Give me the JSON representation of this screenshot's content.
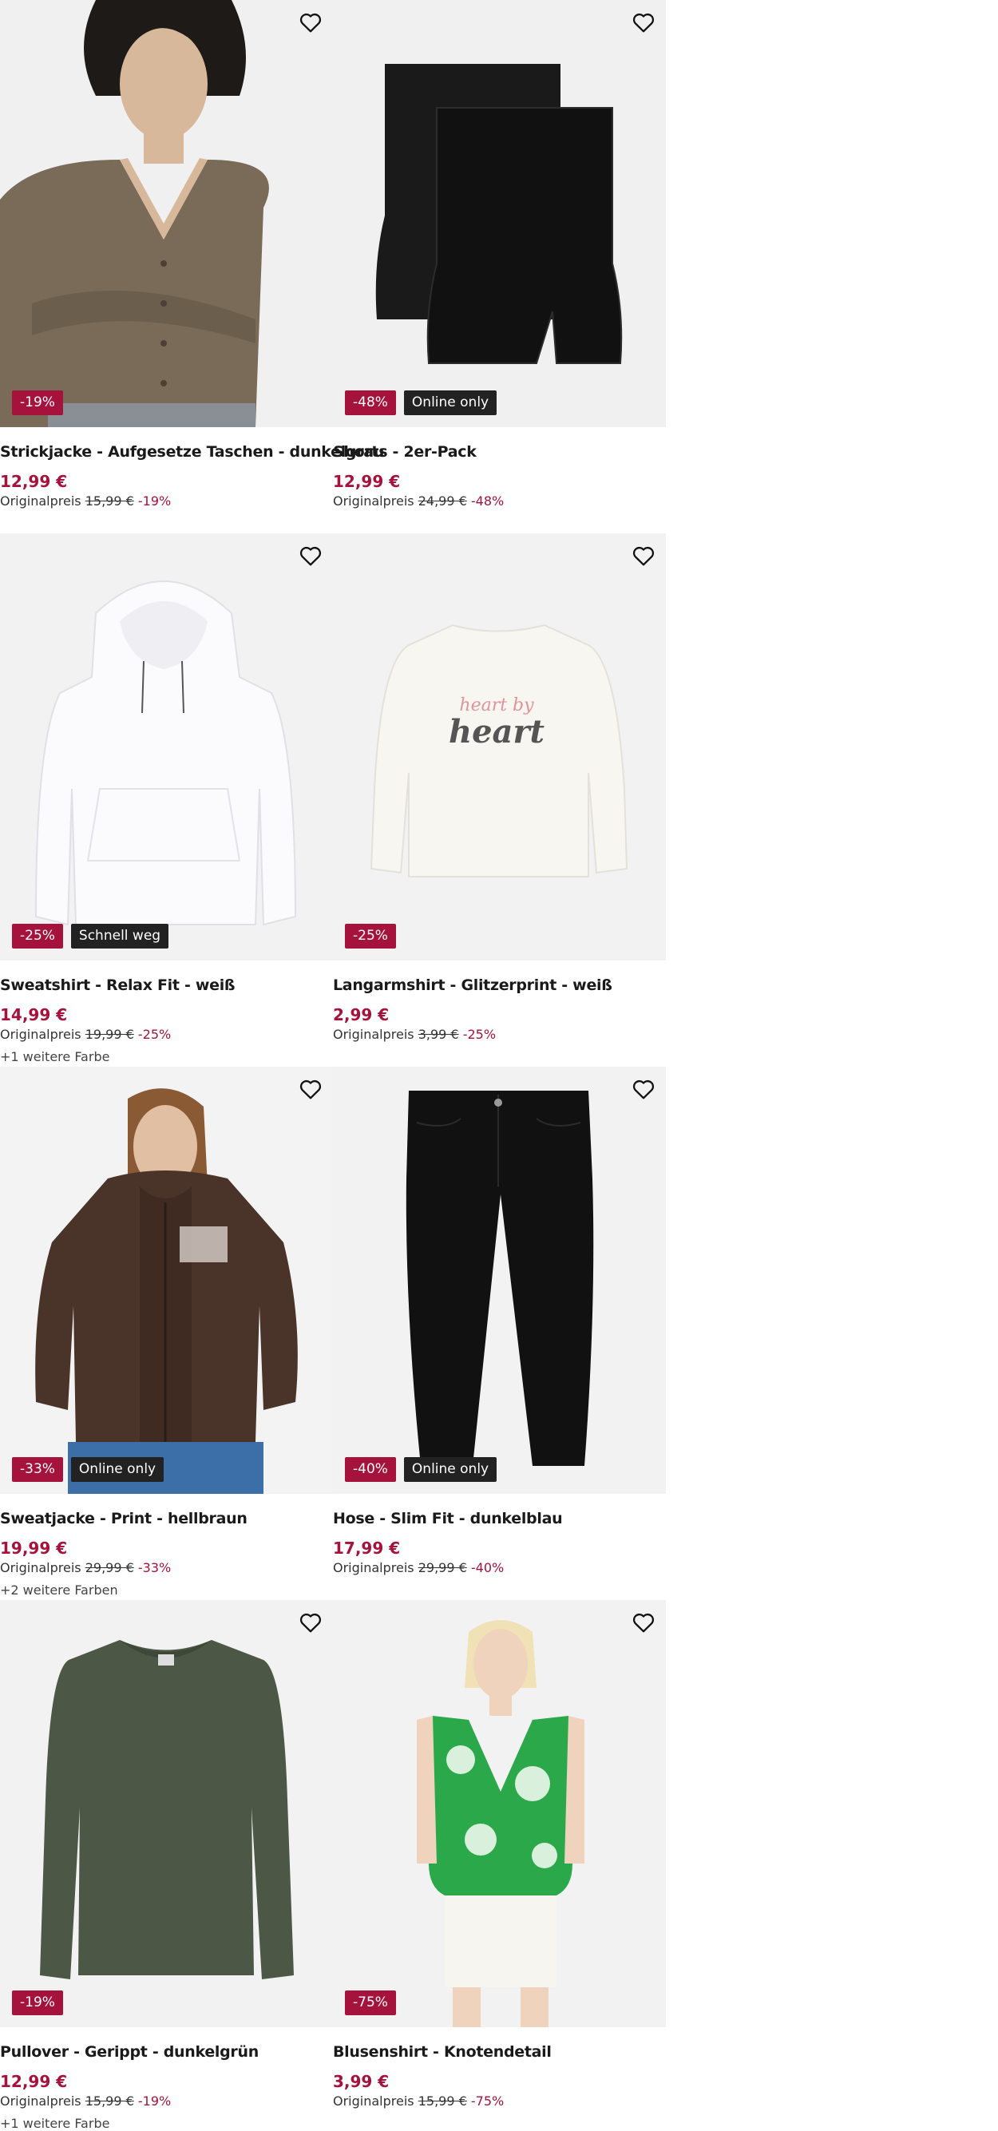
{
  "colors": {
    "sale": "#a5123c",
    "label_bg": "#222222",
    "image_bg": "#f2f2f2"
  },
  "products": [
    {
      "title": "Strickjacke - Aufgesetze Taschen - dunkelgrau",
      "price": "12,99 €",
      "orig_label": "Originalpreis",
      "orig_price": "15,99 €",
      "orig_pct": "-19%",
      "discount": "-19%",
      "label": "",
      "colors": "",
      "image": "cardigan-woman"
    },
    {
      "title": "Shorts - 2er-Pack",
      "price": "12,99 €",
      "orig_label": "Originalpreis",
      "orig_price": "24,99 €",
      "orig_pct": "-48%",
      "discount": "-48%",
      "label": "Online only",
      "colors": "",
      "image": "black-shorts"
    },
    {
      "title": "Sweatshirt - Relax Fit - weiß",
      "price": "14,99 €",
      "orig_label": "Originalpreis",
      "orig_price": "19,99 €",
      "orig_pct": "-25%",
      "discount": "-25%",
      "label": "Schnell weg",
      "colors": "+1 weitere Farbe",
      "image": "white-hoodie"
    },
    {
      "title": "Langarmshirt - Glitzerprint - weiß",
      "price": "2,99 €",
      "orig_label": "Originalpreis",
      "orig_price": "3,99 €",
      "orig_pct": "-25%",
      "discount": "-25%",
      "label": "",
      "colors": "",
      "image": "heart-shirt"
    },
    {
      "title": "Sweatjacke - Print - hellbraun",
      "price": "19,99 €",
      "orig_label": "Originalpreis",
      "orig_price": "29,99 €",
      "orig_pct": "-33%",
      "discount": "-33%",
      "label": "Online only",
      "colors": "+2 weitere Farben",
      "image": "brown-zip-hoodie"
    },
    {
      "title": "Hose - Slim Fit - dunkelblau",
      "price": "17,99 €",
      "orig_label": "Originalpreis",
      "orig_price": "29,99 €",
      "orig_pct": "-40%",
      "discount": "-40%",
      "label": "Online only",
      "colors": "",
      "image": "black-pants"
    },
    {
      "title": "Pullover - Gerippt - dunkelgrün",
      "price": "12,99 €",
      "orig_label": "Originalpreis",
      "orig_price": "15,99 €",
      "orig_pct": "-19%",
      "discount": "-19%",
      "label": "",
      "colors": "+1 weitere Farbe",
      "image": "green-sweater"
    },
    {
      "title": "Blusenshirt - Knotendetail",
      "price": "3,99 €",
      "orig_label": "Originalpreis",
      "orig_price": "15,99 €",
      "orig_pct": "-75%",
      "discount": "-75%",
      "label": "",
      "colors": "",
      "image": "floral-blouse"
    }
  ]
}
